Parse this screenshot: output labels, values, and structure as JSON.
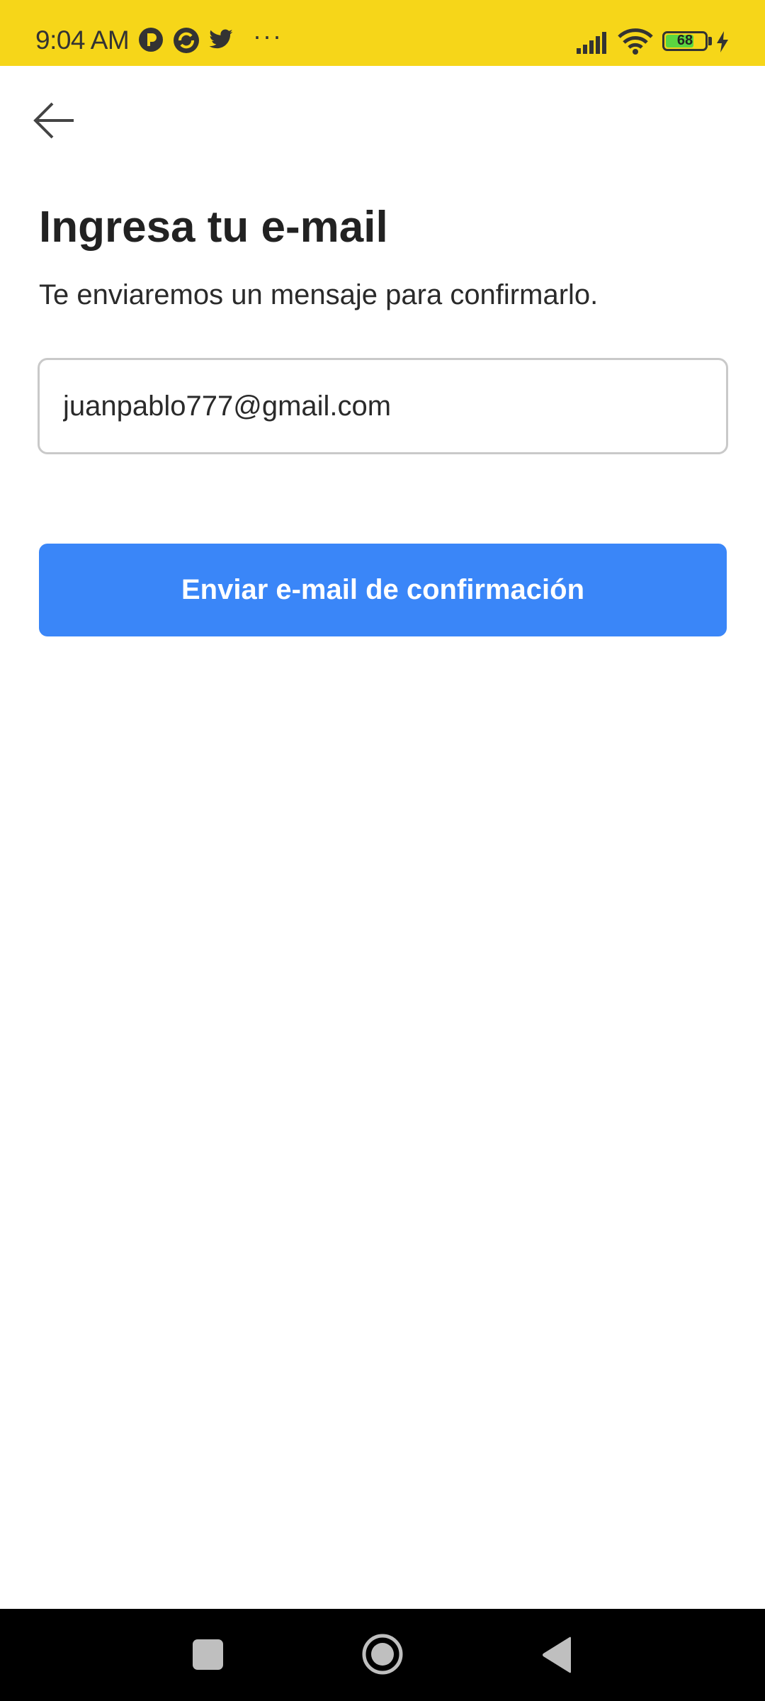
{
  "status_bar": {
    "time": "9:04 AM",
    "battery_level": "68",
    "icons": [
      "notification-app-icon",
      "sync-app-icon",
      "twitter-icon",
      "more-dots-icon",
      "signal-icon",
      "wifi-icon",
      "battery-icon",
      "charging-icon"
    ],
    "more_dots": "···"
  },
  "header": {
    "back_icon": "arrow-left-icon"
  },
  "main": {
    "title": "Ingresa tu e-mail",
    "subtitle": "Te enviaremos un mensaje para confirmarlo.",
    "email_value": "juanpablo777@gmail.com",
    "submit_label": "Enviar e-mail de confirmación"
  },
  "nav_bar": {
    "buttons": [
      "recents-icon",
      "home-icon",
      "back-triangle-icon"
    ]
  },
  "colors": {
    "status_bar_bg": "#f6d619",
    "primary_button": "#3a86f8",
    "battery_fill": "#5bd640"
  }
}
